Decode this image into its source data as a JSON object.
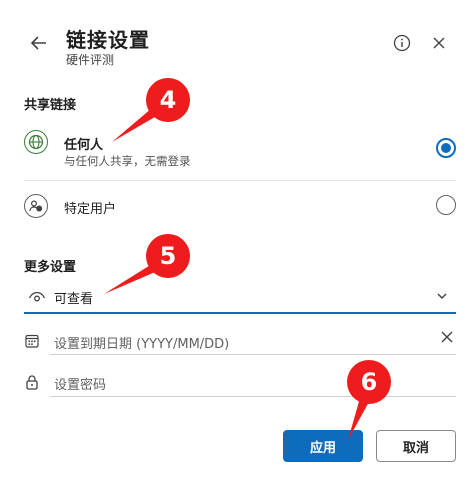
{
  "header": {
    "title": "链接设置",
    "subtitle": "硬件评测"
  },
  "sharing": {
    "section_title": "共享链接",
    "options": [
      {
        "label": "任何人",
        "description": "与任何人共享，无需登录",
        "selected": true,
        "icon": "globe-icon"
      },
      {
        "label": "特定用户",
        "selected": false,
        "icon": "people-icon"
      }
    ]
  },
  "more_settings": {
    "section_title": "更多设置",
    "permission": "可查看",
    "expiry_placeholder": "设置到期日期 (YYYY/MM/DD)",
    "password_placeholder": "设置密码"
  },
  "buttons": {
    "apply": "应用",
    "cancel": "取消"
  },
  "annotations": [
    "4",
    "5",
    "6"
  ],
  "colors": {
    "accent": "#0f6cbd",
    "annotation": "#ee1c1c",
    "globe": "#3a7d3a"
  }
}
